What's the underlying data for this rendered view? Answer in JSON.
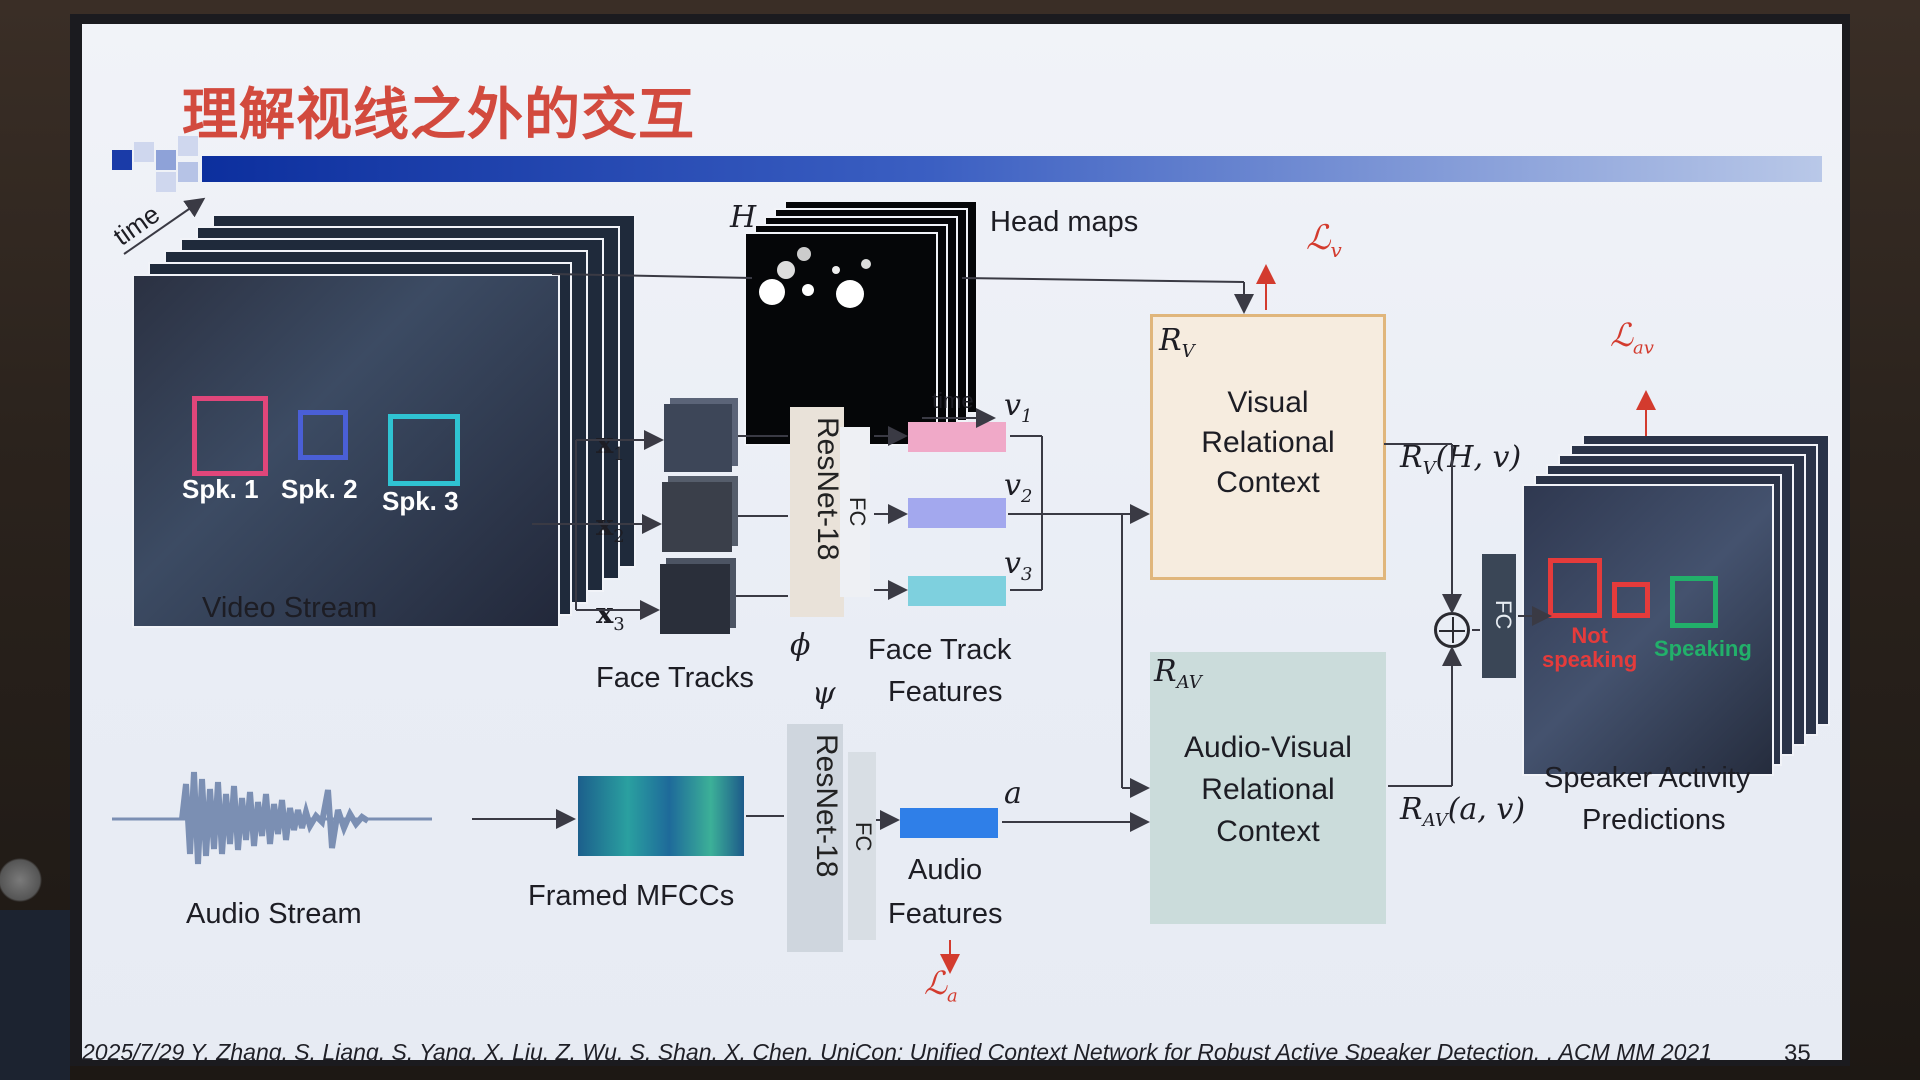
{
  "title": "理解视线之外的交互",
  "labels": {
    "time_diag": "time",
    "H": "H",
    "head_maps": "Head maps",
    "L_v": "ℒ",
    "L_v_sub": "v",
    "R_V": "R",
    "R_V_sub": "V",
    "visual_ctx": [
      "Visual",
      "Relational",
      "Context"
    ],
    "L_av": "ℒ",
    "L_av_sub": "av",
    "RV_out": "R",
    "RV_out_sub": "V",
    "RV_out_args": "(H, v)",
    "spk1": "Spk. 1",
    "spk2": "Spk. 2",
    "spk3": "Spk. 3",
    "video_stream": "Video Stream",
    "x1": "x",
    "x1_sub": "1",
    "x2": "x",
    "x2_sub": "2",
    "x3": "x",
    "x3_sub": "3",
    "resnet_face": "ResNet-18",
    "fc_face": "FC",
    "time_small": "time",
    "v1": "v",
    "v1_sub": "1",
    "v2": "v",
    "v2_sub": "2",
    "v3": "v",
    "v3_sub": "3",
    "phi": "ϕ",
    "face_tracks": "Face Tracks",
    "face_track_features": [
      "Face Track",
      "Features"
    ],
    "psi": "ψ",
    "R_AV": "R",
    "R_AV_sub": "AV",
    "av_ctx": [
      "Audio-Visual",
      "Relational",
      "Context"
    ],
    "fc_pred": "FC",
    "not_speaking": [
      "Not",
      "speaking"
    ],
    "speaking": "Speaking",
    "speaker_activity": [
      "Speaker Activity",
      "Predictions"
    ],
    "RAV_out": "R",
    "RAV_out_sub": "AV",
    "RAV_out_args": "(a, v)",
    "a": "a",
    "resnet_audio": "ResNet-18",
    "fc_audio": "FC",
    "audio_stream": "Audio Stream",
    "framed_mfccs": "Framed MFCCs",
    "audio_features": [
      "Audio",
      "Features"
    ],
    "L_a": "ℒ",
    "L_a_sub": "a"
  },
  "footer": "2025/7/29  Y. Zhang, S. Liang, S. Yang, X. Liu, Z. Wu, S. Shan, X. Chen. UniCon: Unified Context Network for Robust Active Speaker Detection. , ACM MM 2021",
  "page_number": "35",
  "colors": {
    "title": "#d24a3e",
    "spk1_box": "#e0467a",
    "spk2_box": "#4a5fd6",
    "spk3_box": "#2fc3d2",
    "v1_feat": "#f0a9c8",
    "v2_feat": "#a3a8ee",
    "v3_feat": "#7ed0de",
    "audio_feat": "#2f7fe8",
    "visual_box_border": "#e0b67c",
    "av_box_fill": "#cbdcdb",
    "not_speaking": "#e53b3b",
    "speaking": "#22b06a",
    "loss": "#d33b2e"
  }
}
